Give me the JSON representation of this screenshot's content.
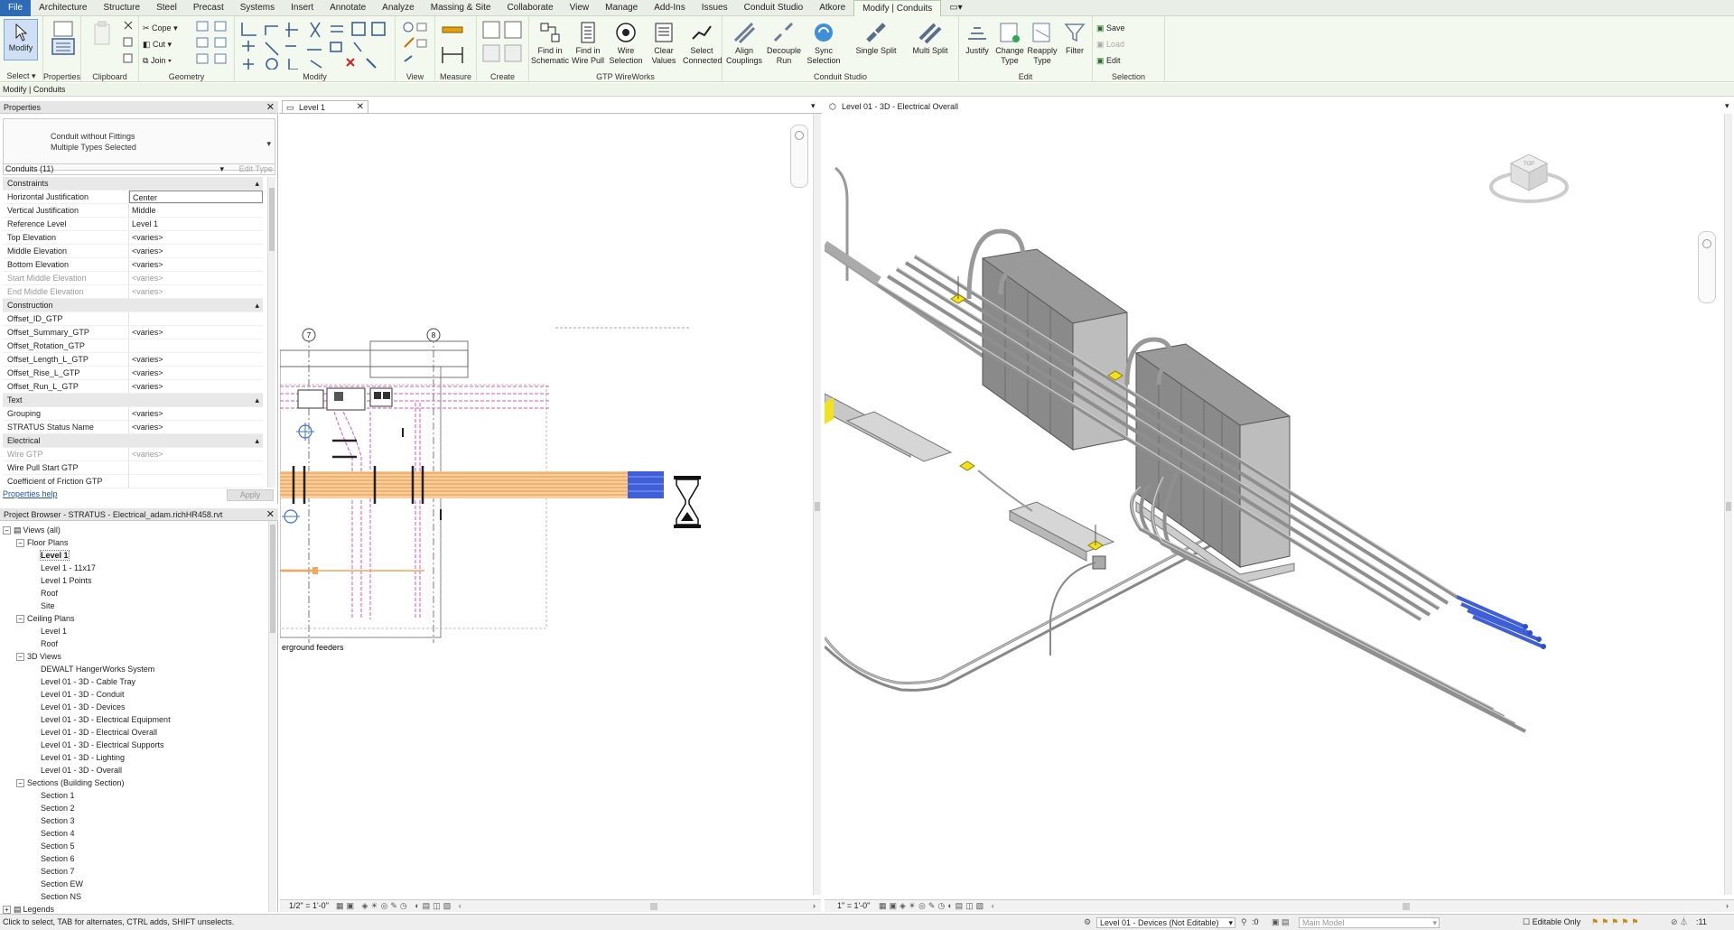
{
  "menu": {
    "tabs": [
      "File",
      "Architecture",
      "Structure",
      "Steel",
      "Precast",
      "Systems",
      "Insert",
      "Annotate",
      "Analyze",
      "Massing & Site",
      "Collaborate",
      "View",
      "Manage",
      "Add-Ins",
      "Issues",
      "Conduit Studio",
      "Atkore",
      "Modify | Conduits"
    ],
    "active_tab": "Modify | Conduits"
  },
  "ribbon": {
    "groups": {
      "select": "Select",
      "properties": "Properties",
      "clipboard": "Clipboard",
      "geometry": "Geometry",
      "modify": "Modify",
      "view": "View",
      "measure": "Measure",
      "create": "Create",
      "gtp_wireworks": "GTP WireWorks",
      "conduit_studio": "Conduit Studio",
      "edit": "Edit",
      "selection": "Selection"
    },
    "modify_button": "Modify",
    "geometry": {
      "cope": "Cope",
      "cut": "Cut",
      "join": "Join"
    },
    "gtp_buttons": [
      {
        "line1": "Find in",
        "line2": "Schematic"
      },
      {
        "line1": "Find in",
        "line2": "Wire Pull"
      },
      {
        "line1": "Wire",
        "line2": "Selection"
      },
      {
        "line1": "Clear",
        "line2": "Values"
      },
      {
        "line1": "Select",
        "line2": "Connected"
      }
    ],
    "cs_buttons": [
      {
        "line1": "Align",
        "line2": "Couplings"
      },
      {
        "line1": "Decouple",
        "line2": "Run"
      },
      {
        "line1": "Sync",
        "line2": "Selection"
      }
    ],
    "split_buttons": {
      "single": "Single Split",
      "multi": "Multi Split"
    },
    "edit_buttons": [
      {
        "line1": "Justify",
        "line2": ""
      },
      {
        "line1": "Change",
        "line2": "Type"
      },
      {
        "line1": "Reapply",
        "line2": "Type"
      },
      {
        "line1": "Filter",
        "line2": ""
      }
    ],
    "selection_buttons": {
      "save": "Save",
      "load": "Load",
      "edit": "Edit"
    }
  },
  "context_bar": "Modify | Conduits",
  "properties": {
    "title": "Properties",
    "type_line1": "Conduit without Fittings",
    "type_line2": "Multiple Types Selected",
    "filter": "Conduits (11)",
    "edit_type": "Edit Type",
    "rows": [
      {
        "kind": "sec",
        "name": "Constraints"
      },
      {
        "kind": "row",
        "name": "Horizontal Justification",
        "value": "Center",
        "boxed": true
      },
      {
        "kind": "row",
        "name": "Vertical Justification",
        "value": "Middle"
      },
      {
        "kind": "row",
        "name": "Reference Level",
        "value": "Level 1"
      },
      {
        "kind": "row",
        "name": "Top Elevation",
        "value": "<varies>"
      },
      {
        "kind": "row",
        "name": "Middle Elevation",
        "value": "<varies>"
      },
      {
        "kind": "row",
        "name": "Bottom Elevation",
        "value": "<varies>"
      },
      {
        "kind": "dis",
        "name": "Start Middle Elevation",
        "value": "<varies>"
      },
      {
        "kind": "dis",
        "name": "End Middle Elevation",
        "value": "<varies>"
      },
      {
        "kind": "sec",
        "name": "Construction"
      },
      {
        "kind": "row",
        "name": "Offset_ID_GTP",
        "value": ""
      },
      {
        "kind": "row",
        "name": "Offset_Summary_GTP",
        "value": "<varies>"
      },
      {
        "kind": "row",
        "name": "Offset_Rotation_GTP",
        "value": ""
      },
      {
        "kind": "row",
        "name": "Offset_Length_L_GTP",
        "value": "<varies>"
      },
      {
        "kind": "row",
        "name": "Offset_Rise_L_GTP",
        "value": "<varies>"
      },
      {
        "kind": "row",
        "name": "Offset_Run_L_GTP",
        "value": "<varies>"
      },
      {
        "kind": "sec",
        "name": "Text"
      },
      {
        "kind": "row",
        "name": "Grouping",
        "value": "<varies>"
      },
      {
        "kind": "row",
        "name": "STRATUS Status Name",
        "value": "<varies>"
      },
      {
        "kind": "sec",
        "name": "Electrical"
      },
      {
        "kind": "dis",
        "name": "Wire GTP",
        "value": "<varies>"
      },
      {
        "kind": "row",
        "name": "Wire Pull Start GTP",
        "value": ""
      },
      {
        "kind": "row",
        "name": "Coefficient of Friction GTP",
        "value": ""
      }
    ],
    "help": "Properties help",
    "apply": "Apply"
  },
  "browser": {
    "title": "Project Browser - STRATUS - Electrical_adam.richHR458.rvt",
    "nodes": [
      {
        "level": 0,
        "toggle": "−",
        "label": "Views (all)"
      },
      {
        "level": 1,
        "toggle": "−",
        "label": "Floor Plans"
      },
      {
        "level": 2,
        "toggle": "",
        "label": "Level 1",
        "selected": true
      },
      {
        "level": 2,
        "toggle": "",
        "label": "Level 1 - 11x17"
      },
      {
        "level": 2,
        "toggle": "",
        "label": "Level 1 Points"
      },
      {
        "level": 2,
        "toggle": "",
        "label": "Roof"
      },
      {
        "level": 2,
        "toggle": "",
        "label": "Site"
      },
      {
        "level": 1,
        "toggle": "−",
        "label": "Ceiling Plans"
      },
      {
        "level": 2,
        "toggle": "",
        "label": "Level 1"
      },
      {
        "level": 2,
        "toggle": "",
        "label": "Roof"
      },
      {
        "level": 1,
        "toggle": "−",
        "label": "3D Views"
      },
      {
        "level": 2,
        "toggle": "",
        "label": "DEWALT HangerWorks System"
      },
      {
        "level": 2,
        "toggle": "",
        "label": "Level 01 - 3D - Cable Tray"
      },
      {
        "level": 2,
        "toggle": "",
        "label": "Level 01 - 3D - Conduit"
      },
      {
        "level": 2,
        "toggle": "",
        "label": "Level 01 - 3D - Devices"
      },
      {
        "level": 2,
        "toggle": "",
        "label": "Level 01 - 3D - Electrical Equipment"
      },
      {
        "level": 2,
        "toggle": "",
        "label": "Level 01 - 3D - Electrical Overall"
      },
      {
        "level": 2,
        "toggle": "",
        "label": "Level 01 - 3D - Electrical Supports"
      },
      {
        "level": 2,
        "toggle": "",
        "label": "Level 01 - 3D - Lighting"
      },
      {
        "level": 2,
        "toggle": "",
        "label": "Level 01 - 3D - Overall"
      },
      {
        "level": 1,
        "toggle": "−",
        "label": "Sections (Building Section)"
      },
      {
        "level": 2,
        "toggle": "",
        "label": "Section 1"
      },
      {
        "level": 2,
        "toggle": "",
        "label": "Section 2"
      },
      {
        "level": 2,
        "toggle": "",
        "label": "Section 3"
      },
      {
        "level": 2,
        "toggle": "",
        "label": "Section 4"
      },
      {
        "level": 2,
        "toggle": "",
        "label": "Section 5"
      },
      {
        "level": 2,
        "toggle": "",
        "label": "Section 6"
      },
      {
        "level": 2,
        "toggle": "",
        "label": "Section 7"
      },
      {
        "level": 2,
        "toggle": "",
        "label": "Section EW"
      },
      {
        "level": 2,
        "toggle": "",
        "label": "Section NS"
      },
      {
        "level": 0,
        "toggle": "+",
        "label": "Legends"
      }
    ]
  },
  "view_plan": {
    "tab": "Level 1",
    "scale": "1/2\" = 1'-0\"",
    "grid_7": "7",
    "grid_8": "8",
    "annotation": "erground feeders"
  },
  "view_3d": {
    "tab": "Level 01 - 3D - Electrical Overall",
    "scale": "1\" = 1'-0\"",
    "cube_label": "TOP"
  },
  "status": {
    "hint": "Click to select, TAB for alternates, CTRL adds, SHIFT unselects.",
    "workset": "Level 01 - Devices (Not Editable)",
    "zero": ":0",
    "model": "Main Model",
    "editable_only": "Editable Only",
    "count": ":11"
  },
  "colors": {
    "accent": "#2d6bb4",
    "ribbon_bg": "#f4f9ef",
    "conduit_orange": "#f3a65c",
    "conduit_pink": "#e34fc1",
    "conduit_blue": "#3f5fd8",
    "device_yellow": "#f1e21d"
  },
  "icons": [
    "modify-arrow-icon",
    "properties-icon",
    "paste-icon",
    "cut-icon",
    "copy-icon",
    "join-icon",
    "align-icon",
    "move-icon",
    "rotate-icon",
    "trim-icon",
    "delete-icon",
    "measure-icon",
    "filter-icon",
    "save-icon",
    "hourglass-icon",
    "view-cube-icon",
    "zoom-icon"
  ]
}
